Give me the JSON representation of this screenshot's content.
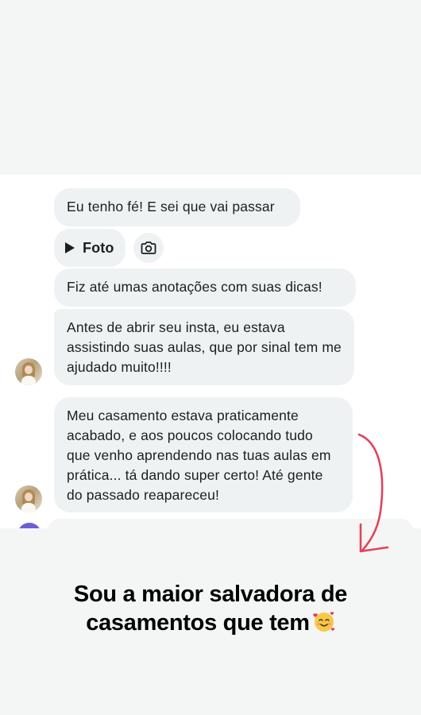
{
  "chat": {
    "messages": [
      {
        "id": "m1",
        "text": "Eu tenho fé! E sei que vai passar"
      },
      {
        "id": "attachment",
        "label": "Foto",
        "icon": "play-icon",
        "action_icon": "camera-icon"
      },
      {
        "id": "m2",
        "text": "Fiz até umas anotações com suas dicas!"
      },
      {
        "id": "m3",
        "text": "Antes de abrir seu insta, eu estava assistindo suas aulas, que por sinal tem me ajudado muito!!!!"
      },
      {
        "id": "m4",
        "text": "Meu casamento estava praticamente acabado, e aos poucos colocando tudo que venho aprendendo nas tuas aulas em prática... tá dando super certo! Até gente do passado reapareceu!"
      }
    ]
  },
  "caption": {
    "line1": "Sou a maior salvadora de",
    "line2": "casamentos que tem",
    "emoji": "smiling-face-with-hearts-icon"
  },
  "colors": {
    "bubble": "#eff2f3",
    "background": "#f4f5f5",
    "arrow": "#e0455a",
    "purple_avatar": "#6b5fd4"
  }
}
